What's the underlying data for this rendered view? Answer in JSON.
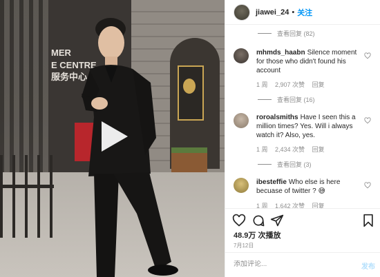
{
  "video": {
    "sign_lines": [
      "MER",
      "E CENTRE",
      "服务中心"
    ],
    "play_icon": "play-icon"
  },
  "header": {
    "username": "jiawei_24",
    "separator": "•",
    "follow_label": "关注"
  },
  "comments": {
    "view_replies": [
      "查看回复 (82)",
      "查看回复 (16)",
      "查看回复 (3)"
    ],
    "items": [
      {
        "username": "mhmds_haabn",
        "text": "Silence moment for those who didn't found his account",
        "time": "1 周",
        "likes": "2,907 次赞",
        "reply": "回复"
      },
      {
        "username": "roroalsmiths",
        "text": "Have I seen this a million times? Yes. Will i always watch it? Also, yes.",
        "time": "1 周",
        "likes": "2,434 次赞",
        "reply": "回复"
      },
      {
        "username": "ibesteffie",
        "text": "Who else is here becuase of twitter ? 😅",
        "time": "1 周",
        "likes": "1,642 次赞",
        "reply": "回复"
      }
    ]
  },
  "actions": {
    "icons": [
      "heart-icon",
      "comment-icon",
      "share-icon",
      "bookmark-icon"
    ]
  },
  "stats": {
    "views": "48.9万 次播放",
    "date": "7月12日"
  },
  "composer": {
    "placeholder": "添加评论...",
    "post_label": "发布"
  },
  "colors": {
    "link": "#0095f6",
    "post_disabled": "#b2dffc",
    "muted": "#8e8e8e"
  }
}
